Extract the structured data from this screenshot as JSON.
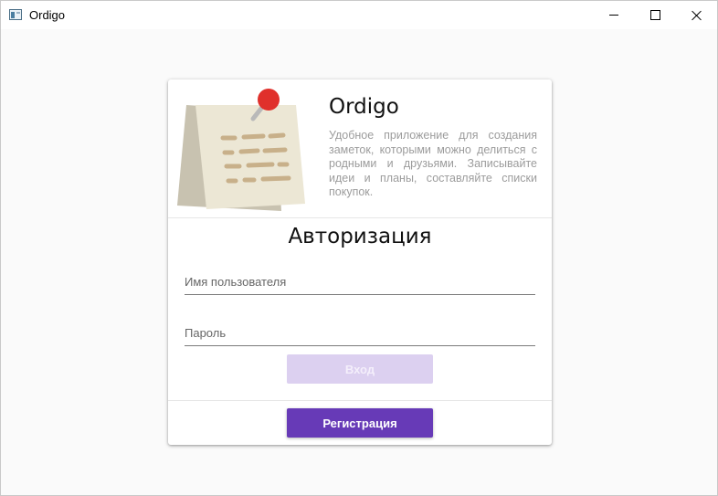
{
  "window": {
    "title": "Ordigo",
    "controls": [
      "minimize-icon",
      "maximize-icon",
      "close-icon"
    ]
  },
  "brand": {
    "name": "Ordigo",
    "description": "Удобное приложение для создания заметок, которыми можно делиться с родными и друзьями. Записывайте идеи и планы, составляйте списки покупок.",
    "illustration": "sticky-note-pin-icon"
  },
  "auth": {
    "title": "Авторизация",
    "username": {
      "label": "Имя пользователя",
      "value": ""
    },
    "password": {
      "label": "Пароль",
      "value": ""
    },
    "login_label": "Вход",
    "login_enabled": false,
    "register_label": "Регистрация"
  },
  "colors": {
    "accent": "#673ab7",
    "accent_disabled": "#dcd0f0",
    "pin": "#e0302b",
    "note_front": "#ece7d5",
    "note_back": "#c8c2b0",
    "note_lines": "#c8b08a"
  }
}
